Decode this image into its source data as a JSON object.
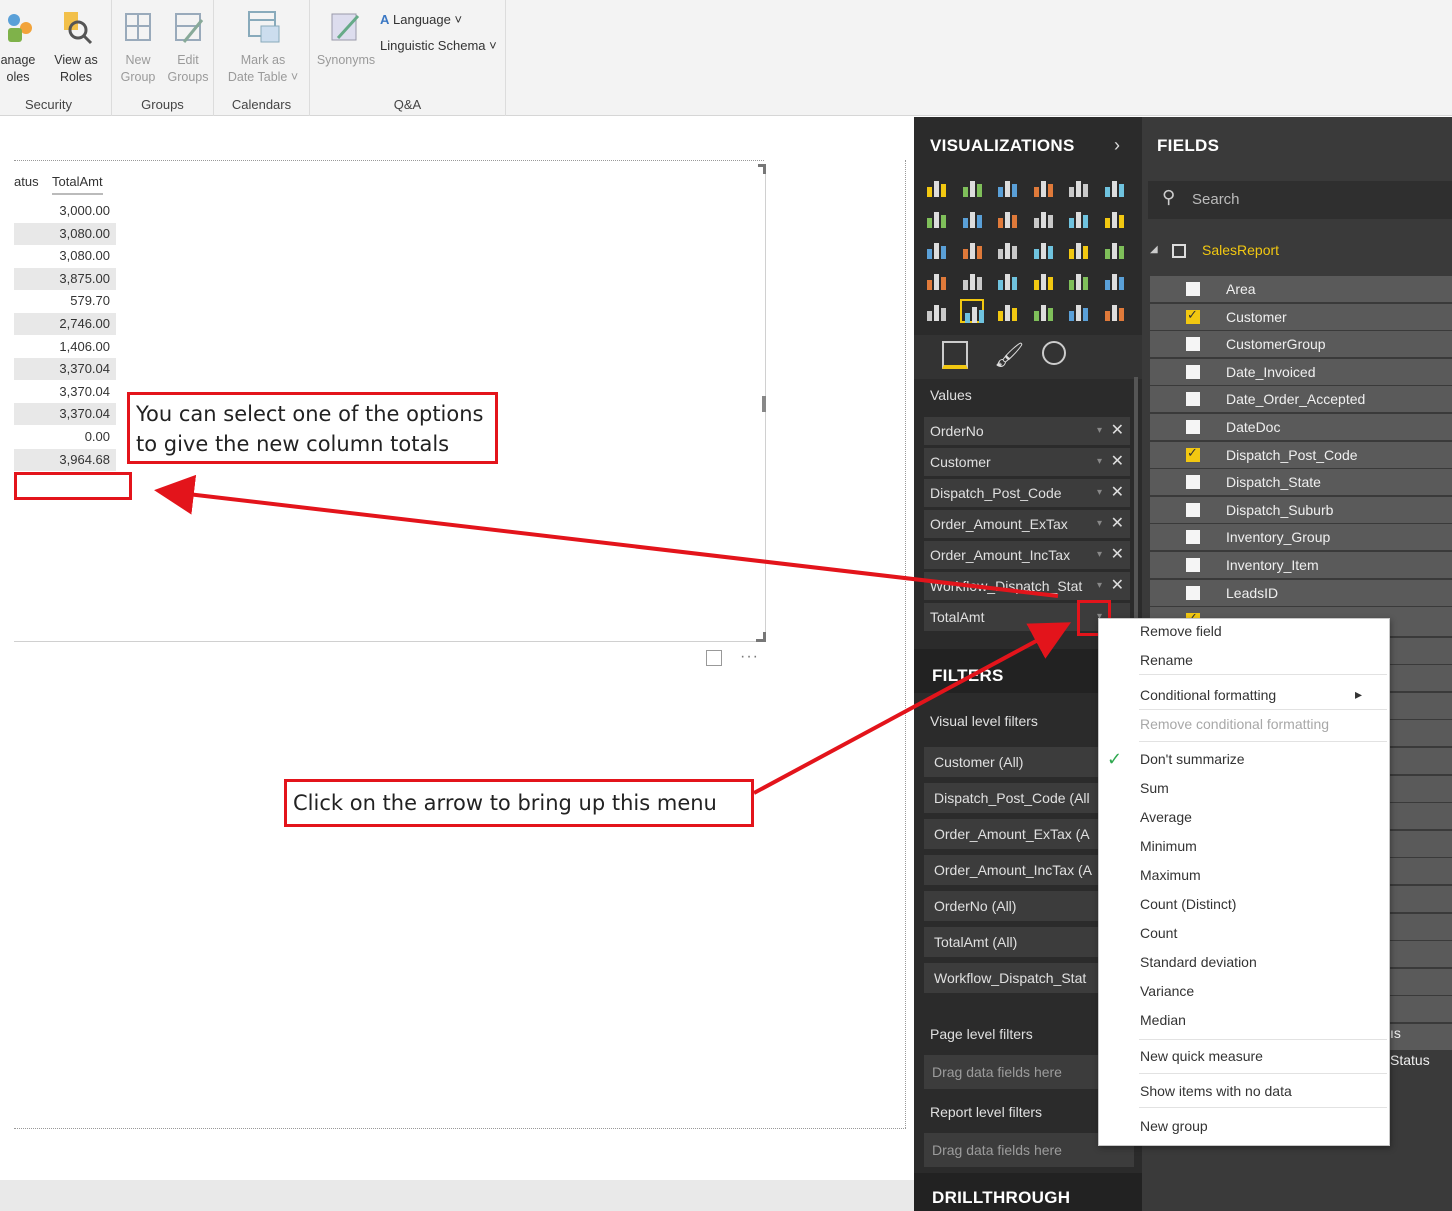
{
  "ribbon": {
    "groups": [
      {
        "label": "Security",
        "buttons": [
          "anage\noles",
          "View as\nRoles"
        ]
      },
      {
        "label": "Groups",
        "buttons": [
          "New\nGroup",
          "Edit\nGroups"
        ]
      },
      {
        "label": "Calendars",
        "buttons": [
          "Mark as\nDate Table ˅"
        ]
      },
      {
        "label": "Q&A",
        "buttons": [
          "Synonyms"
        ]
      }
    ],
    "security_btn1_l1": "anage",
    "security_btn1_l2": "oles",
    "security_btn2_l1": "View as",
    "security_btn2_l2": "Roles",
    "groups_btn1_l1": "New",
    "groups_btn1_l2": "Group",
    "groups_btn2_l1": "Edit",
    "groups_btn2_l2": "Groups",
    "cal_btn_l1": "Mark as",
    "cal_btn_l2": "Date Table ˅",
    "qa_btn": "Synonyms",
    "language": "Language ˅",
    "linguistic_schema": "Linguistic Schema ˅",
    "label_security": "Security",
    "label_groups": "Groups",
    "label_calendars": "Calendars",
    "label_qa": "Q&A"
  },
  "table": {
    "col_status": "atus",
    "col_total": "TotalAmt",
    "values": [
      "3,000.00",
      "3,080.00",
      "3,080.00",
      "3,875.00",
      "579.70",
      "2,746.00",
      "1,406.00",
      "3,370.04",
      "3,370.04",
      "3,370.04",
      "0.00",
      "3,964.68"
    ]
  },
  "callouts": {
    "top_line1": "You can select one of the options",
    "top_line2": "to give the new column totals",
    "bottom": "Click on the arrow to bring up this menu"
  },
  "visualizations": {
    "title": "VISUALIZATIONS",
    "values_label": "Values",
    "wells": [
      "OrderNo",
      "Customer",
      "Dispatch_Post_Code",
      "Order_Amount_ExTax",
      "Order_Amount_IncTax",
      "Workflow_Dispatch_Stat",
      "TotalAmt"
    ],
    "filters_title": "FILTERS",
    "visual_filters_label": "Visual level filters",
    "filters": [
      "Customer  (All)",
      "Dispatch_Post_Code  (All",
      "Order_Amount_ExTax  (A",
      "Order_Amount_IncTax  (A",
      "OrderNo  (All)",
      "TotalAmt  (All)",
      "Workflow_Dispatch_Stat"
    ],
    "page_filters_label": "Page level filters",
    "report_filters_label": "Report level filters",
    "drag_hint": "Drag data fields here",
    "drillthrough_title": "DRILLTHROUGH"
  },
  "fields": {
    "title": "FIELDS",
    "search_placeholder": "Search",
    "table_name": "SalesReport",
    "items": [
      {
        "name": "Area",
        "checked": false
      },
      {
        "name": "Customer",
        "checked": true
      },
      {
        "name": "CustomerGroup",
        "checked": false
      },
      {
        "name": "Date_Invoiced",
        "checked": false
      },
      {
        "name": "Date_Order_Accepted",
        "checked": false
      },
      {
        "name": "DateDoc",
        "checked": false
      },
      {
        "name": "Dispatch_Post_Code",
        "checked": true
      },
      {
        "name": "Dispatch_State",
        "checked": false
      },
      {
        "name": "Dispatch_Suburb",
        "checked": false
      },
      {
        "name": "Inventory_Group",
        "checked": false
      },
      {
        "name": "Inventory_Item",
        "checked": false
      },
      {
        "name": "LeadsID",
        "checked": false
      }
    ],
    "partial_1": "ıs",
    "partial_2": "Status"
  },
  "context_menu": {
    "items": [
      "Remove field",
      "Rename",
      "Conditional formatting",
      "Remove conditional formatting",
      "Don't summarize",
      "Sum",
      "Average",
      "Minimum",
      "Maximum",
      "Count (Distinct)",
      "Count",
      "Standard deviation",
      "Variance",
      "Median",
      "New quick measure",
      "Show items with no data",
      "New group"
    ],
    "selected": "Don't summarize"
  },
  "colors": {
    "annotation_red": "#e3141b",
    "accent_yellow": "#f2c811",
    "pane_dark": "#2b2b2b"
  }
}
